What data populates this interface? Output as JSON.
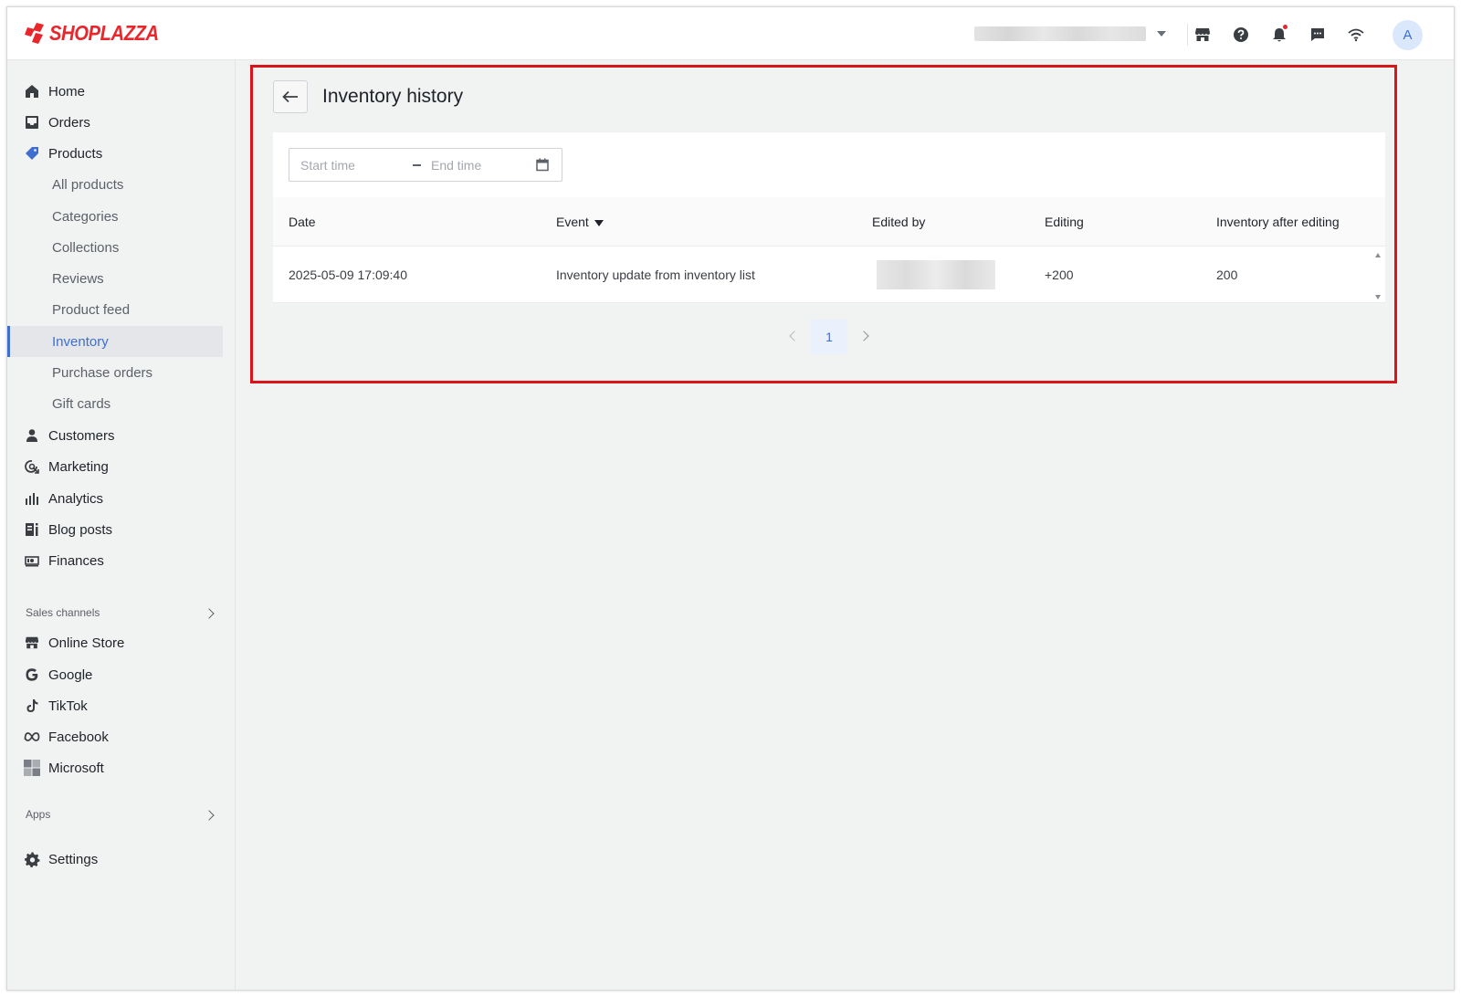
{
  "app": {
    "brand": "SHOPLAZZA",
    "brand_color": "#e8262c",
    "accent_color": "#3e6fd0",
    "highlight_color": "#d9141b"
  },
  "topbar": {
    "avatar_letter": "A",
    "icons": [
      "store-icon",
      "help-icon",
      "bell-icon",
      "chat-icon",
      "wifi-icon"
    ]
  },
  "sidebar": {
    "items": [
      {
        "label": "Home",
        "icon": "home-icon"
      },
      {
        "label": "Orders",
        "icon": "inbox-icon"
      },
      {
        "label": "Products",
        "icon": "tag-icon"
      },
      {
        "label": "Customers",
        "icon": "person-icon"
      },
      {
        "label": "Marketing",
        "icon": "target-icon"
      },
      {
        "label": "Analytics",
        "icon": "bar-chart-icon"
      },
      {
        "label": "Blog posts",
        "icon": "blog-icon"
      },
      {
        "label": "Finances",
        "icon": "money-icon"
      }
    ],
    "product_subitems": [
      {
        "label": "All products"
      },
      {
        "label": "Categories"
      },
      {
        "label": "Collections"
      },
      {
        "label": "Reviews"
      },
      {
        "label": "Product feed"
      },
      {
        "label": "Inventory",
        "active": true
      },
      {
        "label": "Purchase orders"
      },
      {
        "label": "Gift cards"
      }
    ],
    "sales_channels_title": "Sales channels",
    "sales_channels": [
      {
        "label": "Online Store",
        "icon": "store-icon"
      },
      {
        "label": "Google",
        "icon": "google-icon"
      },
      {
        "label": "TikTok",
        "icon": "tiktok-icon"
      },
      {
        "label": "Facebook",
        "icon": "meta-icon"
      },
      {
        "label": "Microsoft",
        "icon": "microsoft-icon"
      }
    ],
    "apps_title": "Apps",
    "settings_label": "Settings"
  },
  "main": {
    "title": "Inventory history",
    "filter": {
      "start_placeholder": "Start time",
      "end_placeholder": "End time"
    },
    "table": {
      "columns": [
        "Date",
        "Event",
        "Edited by",
        "Editing",
        "Inventory after editing"
      ],
      "rows": [
        {
          "date": "2025-05-09 17:09:40",
          "event": "Inventory update from inventory list",
          "editing": "+200",
          "after": "200"
        }
      ]
    },
    "pagination": {
      "current_page": "1"
    }
  }
}
